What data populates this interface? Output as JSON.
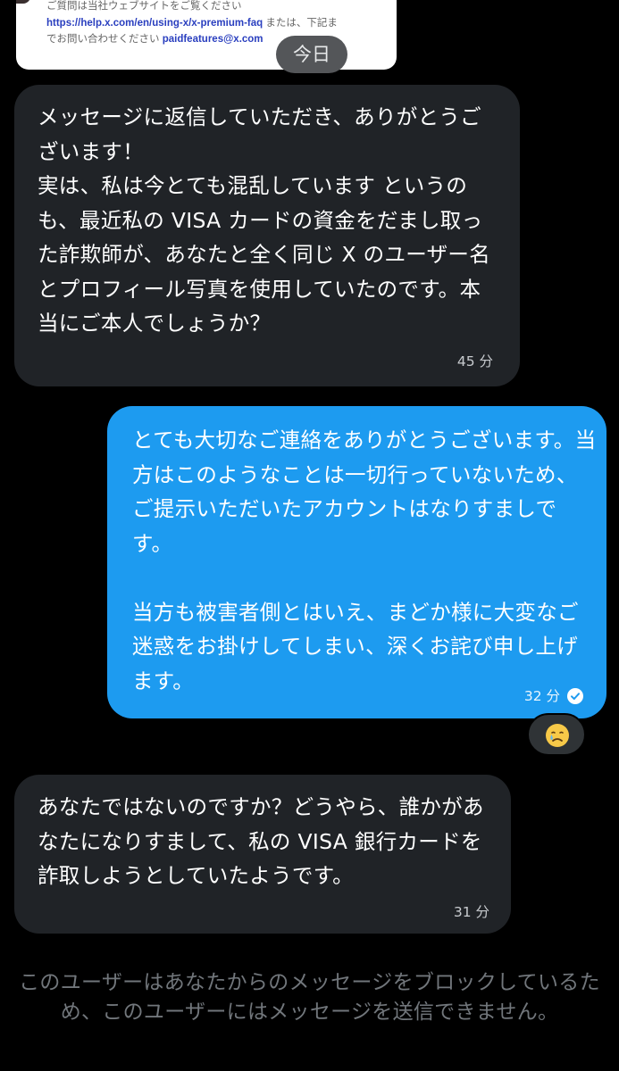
{
  "attachment": {
    "line1": "ご質問は当社ウェブサイトをご覧ください",
    "line2_link": "https://help.x.com/en/using-x/x-premium-faq",
    "line2_rest": " または、下記ま",
    "line3_pre": "でお問い合わせください ",
    "line3_link": "paidfeatures@x.com"
  },
  "date_separator": "今日",
  "messages": [
    {
      "direction": "received",
      "text": "メッセージに返信していただき、ありがとうございます！\n実は、私は今とても混乱しています というのも、最近私の VISA カードの資金をだまし取った詐欺師が、あなたと全く同じ X のユーザー名とプロフィール写真を使用していたのです。本当にご本人でしょうか？",
      "time": "45 分"
    },
    {
      "direction": "sent",
      "text": "とても大切なご連絡をありがとうございます。当方はこのようなことは一切行っていないため、ご提示いただいたアカウントはなりすましです。\n\n当方も被害者側とはいえ、まどか様に大変なご迷惑をお掛けしてしまい、深くお詫び申し上げます。",
      "time": "32 分",
      "reaction": "crying-face"
    },
    {
      "direction": "received",
      "text": "あなたではないのですか？どうやら、誰かがあなたになりすまして、私の VISA 銀行カードを詐取しようとしていたようです。",
      "time": "31 分"
    }
  ],
  "blocked_notice": "このユーザーはあなたからのメッセージをブロックしているため、このユーザーにはメッセージを送信できません。",
  "colors": {
    "background": "#000000",
    "received_bubble": "#202327",
    "sent_bubble": "#1d9bf0",
    "muted_text": "#71767b"
  }
}
